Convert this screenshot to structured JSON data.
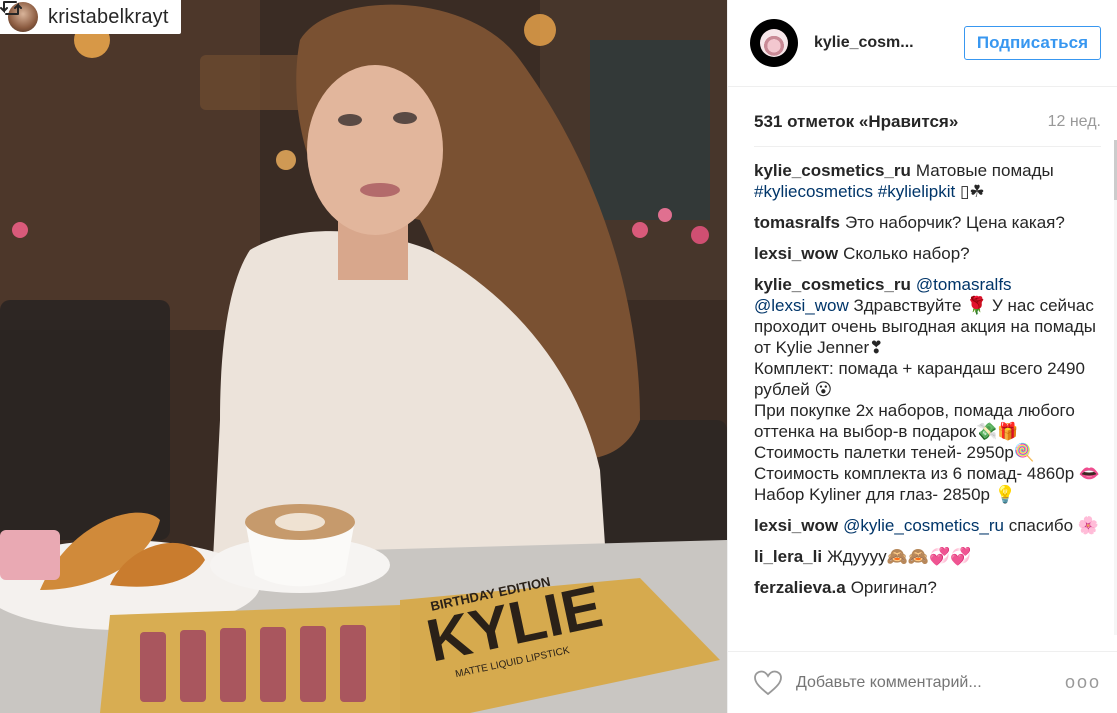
{
  "repost": {
    "username": "kristabelkrayt"
  },
  "post": {
    "author": "kylie_cosm...",
    "follow_label": "Подписаться",
    "likes_label": "531 отметок «Нравится»",
    "time_ago": "12 нед.",
    "comments": [
      {
        "user": "kylie_cosmetics_ru",
        "text": "Матовые помады",
        "tags": "#kyliecosmetics #kylielipkit",
        "suffix": " ▯☘"
      },
      {
        "user": "tomasralfs",
        "text": "Это наборчик? Цена какая?"
      },
      {
        "user": "lexsi_wow",
        "text": "Сколько набор?"
      },
      {
        "user": "kylie_cosmetics_ru",
        "tags": "@tomasralfs @lexsi_wow",
        "lines": [
          "Здравствуйте 🌹 У нас сейчас проходит очень выгодная акция на помады от Kylie Jenner❣",
          "Комплект: помада + карандаш всего 2490 рублей 😮",
          "При покупке 2х наборов, помада любого оттенка на выбор-в подарок💸🎁",
          "Стоимость палетки теней- 2950р🍭",
          "Стоимость комплекта из 6 помад- 4860р 👄",
          "Набор Kyliner для глаз- 2850р 💡"
        ]
      },
      {
        "user": "lexsi_wow",
        "tags": "@kylie_cosmetics_ru",
        "text": "спасибо 🌸"
      },
      {
        "user": "li_lera_li",
        "text": "Ждуууу🙈🙈💞💞"
      },
      {
        "user": "ferzalieva.a",
        "text": "Оригинал?"
      }
    ],
    "comment_placeholder": "Добавьте комментарий...",
    "more_label": "ooo"
  },
  "photo": {
    "box_brand": "KYLIE",
    "box_edition": "BIRTHDAY EDITION",
    "box_subtitle": "MATTE LIQUID LIPSTICK"
  },
  "colors": {
    "accent": "#3897f0",
    "link": "#003569",
    "muted": "#999999"
  }
}
